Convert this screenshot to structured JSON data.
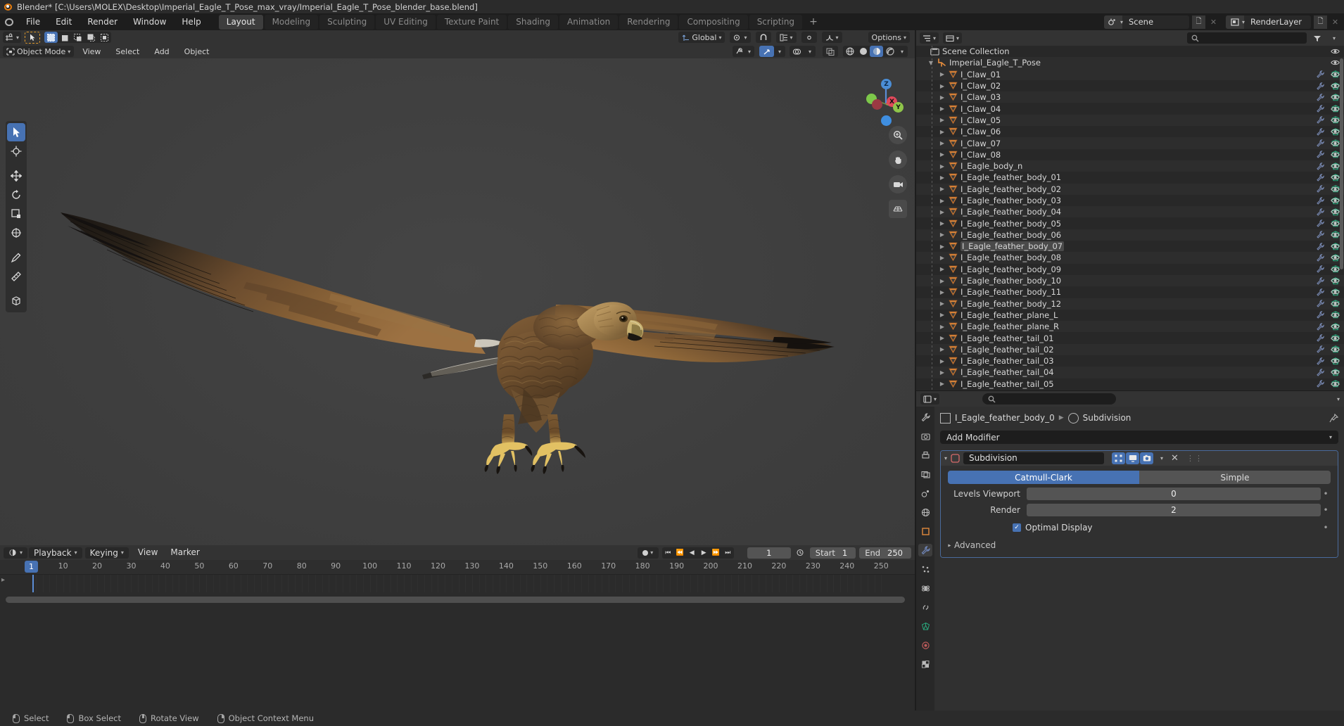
{
  "titlebar": {
    "text": "Blender* [C:\\Users\\MOLEX\\Desktop\\Imperial_Eagle_T_Pose_max_vray/Imperial_Eagle_T_Pose_blender_base.blend]",
    "logo_icon": "blender-logo-icon"
  },
  "topbar": {
    "menus": [
      "File",
      "Edit",
      "Render",
      "Window",
      "Help"
    ],
    "workspaces": [
      {
        "label": "Layout",
        "active": true
      },
      {
        "label": "Modeling",
        "active": false
      },
      {
        "label": "Sculpting",
        "active": false
      },
      {
        "label": "UV Editing",
        "active": false
      },
      {
        "label": "Texture Paint",
        "active": false
      },
      {
        "label": "Shading",
        "active": false
      },
      {
        "label": "Animation",
        "active": false
      },
      {
        "label": "Rendering",
        "active": false
      },
      {
        "label": "Compositing",
        "active": false
      },
      {
        "label": "Scripting",
        "active": false
      }
    ],
    "add_workspace_label": "+",
    "scene": {
      "label": "Scene",
      "icon": "scene-icon",
      "new_icon": "copy-icon",
      "unlink_icon": "x-icon"
    },
    "viewlayer": {
      "label": "RenderLayer",
      "icon": "viewlayer-icon",
      "new_icon": "copy-icon",
      "unlink_icon": "x-icon"
    }
  },
  "viewport_header": {
    "editor_type_icon": "editor-type-icon",
    "select_tool_icon": "cursor-arrow-icon",
    "select_modes": [
      "set",
      "extend",
      "subtract",
      "invert",
      "intersect"
    ],
    "transform_orientation": "Global",
    "snap_icon": "magnet-icon",
    "proportional_icon": "proportional-edit-icon",
    "options_label": "Options",
    "mode": "Object Mode",
    "menus": [
      "View",
      "Select",
      "Add",
      "Object"
    ],
    "shading_modes": [
      "wireframe",
      "solid",
      "material-preview",
      "rendered"
    ],
    "active_shading": "material-preview",
    "visibility_icon": "visibility-icon",
    "gizmo_icon": "gizmo-icon",
    "overlays_icon": "overlays-icon",
    "xray_icon": "xray-icon"
  },
  "toolbar": {
    "tools": [
      {
        "name": "tweak-tool",
        "icon": "cursor-arrow-icon",
        "active": true
      },
      {
        "name": "cursor-tool",
        "icon": "3d-cursor-icon",
        "active": false
      },
      {
        "name": "move-tool",
        "icon": "move-arrows-icon",
        "active": false
      },
      {
        "name": "rotate-tool",
        "icon": "rotate-icon",
        "active": false
      },
      {
        "name": "scale-tool",
        "icon": "scale-icon",
        "active": false
      },
      {
        "name": "transform-tool",
        "icon": "transform-icon",
        "active": false
      },
      {
        "name": "annotate-tool",
        "icon": "pencil-icon",
        "active": false
      },
      {
        "name": "measure-tool",
        "icon": "ruler-icon",
        "active": false
      },
      {
        "name": "add-cube-tool",
        "icon": "add-cube-icon",
        "active": false
      }
    ]
  },
  "viewport": {
    "gizmo_axes": [
      "Z",
      "X",
      "Y"
    ],
    "nav_icons": [
      "zoom-icon",
      "hand-pan-icon",
      "camera-icon",
      "grid-ortho-icon"
    ]
  },
  "outliner": {
    "header": {
      "editor_icon": "outliner-icon",
      "display_mode": "View Layer",
      "filter_icon": "filter-icon",
      "search_placeholder": "",
      "search_icon": "search-icon"
    },
    "scene_collection": "Scene Collection",
    "collection": "Imperial_Eagle_T_Pose",
    "objects": [
      {
        "name": "I_Claw_01",
        "modifier": true,
        "mesh": true
      },
      {
        "name": "I_Claw_02",
        "modifier": true,
        "mesh": true
      },
      {
        "name": "I_Claw_03",
        "modifier": true,
        "mesh": true
      },
      {
        "name": "I_Claw_04",
        "modifier": true,
        "mesh": true
      },
      {
        "name": "I_Claw_05",
        "modifier": true,
        "mesh": true
      },
      {
        "name": "I_Claw_06",
        "modifier": true,
        "mesh": true
      },
      {
        "name": "I_Claw_07",
        "modifier": true,
        "mesh": true
      },
      {
        "name": "I_Claw_08",
        "modifier": true,
        "mesh": true
      },
      {
        "name": "I_Eagle_body_n",
        "modifier": true,
        "mesh": true
      },
      {
        "name": "I_Eagle_feather_body_01",
        "modifier": true,
        "mesh": true
      },
      {
        "name": "I_Eagle_feather_body_02",
        "modifier": true,
        "mesh": true
      },
      {
        "name": "I_Eagle_feather_body_03",
        "modifier": true,
        "mesh": true
      },
      {
        "name": "I_Eagle_feather_body_04",
        "modifier": true,
        "mesh": true
      },
      {
        "name": "I_Eagle_feather_body_05",
        "modifier": true,
        "mesh": true
      },
      {
        "name": "I_Eagle_feather_body_06",
        "modifier": true,
        "mesh": true
      },
      {
        "name": "I_Eagle_feather_body_07",
        "modifier": true,
        "mesh": true,
        "selected": true
      },
      {
        "name": "I_Eagle_feather_body_08",
        "modifier": true,
        "mesh": true
      },
      {
        "name": "I_Eagle_feather_body_09",
        "modifier": true,
        "mesh": true
      },
      {
        "name": "I_Eagle_feather_body_10",
        "modifier": true,
        "mesh": true
      },
      {
        "name": "I_Eagle_feather_body_11",
        "modifier": true,
        "mesh": true
      },
      {
        "name": "I_Eagle_feather_body_12",
        "modifier": true,
        "mesh": true
      },
      {
        "name": "I_Eagle_feather_plane_L",
        "modifier": true,
        "mesh": true
      },
      {
        "name": "I_Eagle_feather_plane_R",
        "modifier": true,
        "mesh": true
      },
      {
        "name": "I_Eagle_feather_tail_01",
        "modifier": true,
        "mesh": true
      },
      {
        "name": "I_Eagle_feather_tail_02",
        "modifier": true,
        "mesh": true
      },
      {
        "name": "I_Eagle_feather_tail_03",
        "modifier": true,
        "mesh": true
      },
      {
        "name": "I_Eagle_feather_tail_04",
        "modifier": true,
        "mesh": true
      },
      {
        "name": "I_Eagle_feather_tail_05",
        "modifier": true,
        "mesh": true
      }
    ]
  },
  "properties": {
    "search_placeholder": "",
    "breadcrumb": {
      "object": "I_Eagle_feather_body_0",
      "object_icon": "object-data-icon",
      "modifier": "Subdivision",
      "modifier_icon": "modifier-icon",
      "pin_icon": "pin-icon"
    },
    "tabs": [
      {
        "name": "tool",
        "icon": "tool-icon",
        "active": false
      },
      {
        "name": "render",
        "icon": "camera-back-icon",
        "active": false
      },
      {
        "name": "output",
        "icon": "printer-icon",
        "active": false
      },
      {
        "name": "view-layer",
        "icon": "images-icon",
        "active": false
      },
      {
        "name": "scene",
        "icon": "scene-cone-icon",
        "active": false
      },
      {
        "name": "world",
        "icon": "world-icon",
        "active": false
      },
      {
        "name": "object",
        "icon": "square-orange-icon",
        "active": false
      },
      {
        "name": "modifier",
        "icon": "wrench-icon",
        "active": true
      },
      {
        "name": "particles",
        "icon": "particles-icon",
        "active": false
      },
      {
        "name": "physics",
        "icon": "physics-icon",
        "active": false
      },
      {
        "name": "constraint",
        "icon": "constraint-icon",
        "active": false
      },
      {
        "name": "data",
        "icon": "mesh-data-icon",
        "active": false
      },
      {
        "name": "material",
        "icon": "material-sphere-icon",
        "active": false
      },
      {
        "name": "texture",
        "icon": "checker-icon",
        "active": false
      }
    ],
    "add_modifier_label": "Add Modifier",
    "modifier": {
      "expand_icon": "triangle-down-icon",
      "type_icon": "subsurf-icon",
      "name": "Subdivision",
      "toggles": [
        {
          "name": "edit-mode-display",
          "on": true,
          "icon": "edit-mode-icon"
        },
        {
          "name": "realtime-display",
          "on": true,
          "icon": "monitor-icon"
        },
        {
          "name": "render-display",
          "on": true,
          "icon": "camera-icon"
        }
      ],
      "dropdown_icon": "chevron-down-icon",
      "close_icon": "x-icon",
      "drag_icon": "dots-grip-icon",
      "algorithm_options": [
        "Catmull-Clark",
        "Simple"
      ],
      "algorithm_active": "Catmull-Clark",
      "levels_viewport_label": "Levels Viewport",
      "levels_viewport_value": "0",
      "render_label": "Render",
      "render_value": "2",
      "optimal_display_label": "Optimal Display",
      "optimal_display_checked": true,
      "advanced_label": "Advanced"
    }
  },
  "timeline": {
    "editor_icon": "timeline-icon",
    "menus": [
      {
        "label": "Playback",
        "dropdown": true
      },
      {
        "label": "Keying",
        "dropdown": true
      },
      {
        "label": "View",
        "dropdown": false
      },
      {
        "label": "Marker",
        "dropdown": false
      }
    ],
    "auto_key_icon": "record-dot-icon",
    "transport": [
      "jump-start-icon",
      "prev-keyframe-icon",
      "play-reverse-icon",
      "play-icon",
      "next-keyframe-icon",
      "jump-end-icon"
    ],
    "current_frame": "1",
    "start_label": "Start",
    "start_value": "1",
    "end_label": "End",
    "end_value": "250",
    "ticks": [
      "10",
      "20",
      "30",
      "40",
      "50",
      "60",
      "70",
      "80",
      "90",
      "100",
      "110",
      "120",
      "130",
      "140",
      "150",
      "160",
      "170",
      "180",
      "190",
      "200",
      "210",
      "220",
      "230",
      "240",
      "250"
    ],
    "playhead_label": "1"
  },
  "status": {
    "items": [
      {
        "mouse": "left",
        "label": "Select"
      },
      {
        "mouse": "left",
        "label": "Box Select"
      },
      {
        "mouse": "middle",
        "label": "Rotate View"
      },
      {
        "mouse": "right",
        "label": "Object Context Menu"
      }
    ]
  },
  "colors": {
    "accent_blue": "#4772b3",
    "blender_orange": "#e87d0d",
    "mesh_green": "#2aa67c",
    "modifier_blue": "#7a8bb5",
    "object_orange": "#e08a3c"
  }
}
